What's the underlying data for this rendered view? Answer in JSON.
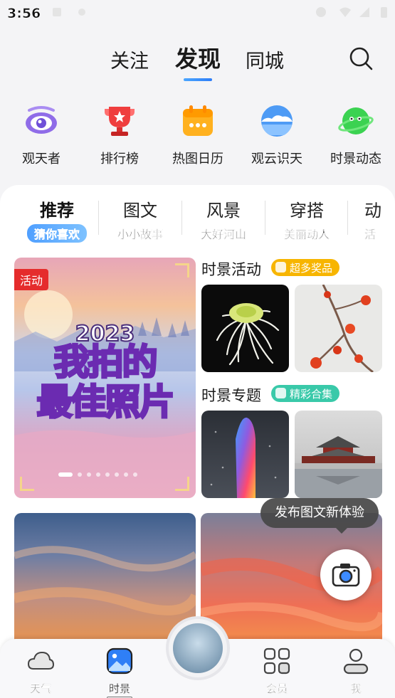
{
  "status_bar": {
    "time": "3:56"
  },
  "top_tabs": [
    {
      "label": "关注",
      "active": false
    },
    {
      "label": "发现",
      "active": true
    },
    {
      "label": "同城",
      "active": false
    }
  ],
  "quick_links": [
    {
      "label": "观天者",
      "icon": "eye-icon"
    },
    {
      "label": "排行榜",
      "icon": "trophy-icon"
    },
    {
      "label": "热图日历",
      "icon": "calendar-icon"
    },
    {
      "label": "观云识天",
      "icon": "cloud-icon"
    },
    {
      "label": "时景动态",
      "icon": "planet-icon"
    }
  ],
  "categories": [
    {
      "main": "推荐",
      "sub": "猜你喜欢",
      "active": true
    },
    {
      "main": "图文",
      "sub": "小小故事",
      "active": false
    },
    {
      "main": "风景",
      "sub": "大好河山",
      "active": false
    },
    {
      "main": "穿搭",
      "sub": "美丽动人",
      "active": false
    },
    {
      "main": "动",
      "sub": "活",
      "active": false
    }
  ],
  "banner": {
    "tag": "活动",
    "year": "2023",
    "line1": "我拍的",
    "line2": "最佳照片",
    "dot_count": 8,
    "current_dot": 0
  },
  "sections": {
    "activity": {
      "title": "时景活动",
      "badge": "超多奖品",
      "badge_color": "#f7b500"
    },
    "topic": {
      "title": "时景专题",
      "badge": "精彩合集",
      "badge_color": "#39c9a9"
    }
  },
  "tooltip": "发布图文新体验",
  "bottom_nav": [
    {
      "label": "天气",
      "icon": "cloud-icon"
    },
    {
      "label": "时景",
      "icon": "photo-icon",
      "active": true
    },
    {
      "label": "会员",
      "icon": "grid-icon"
    },
    {
      "label": "我",
      "icon": "person-icon"
    }
  ]
}
